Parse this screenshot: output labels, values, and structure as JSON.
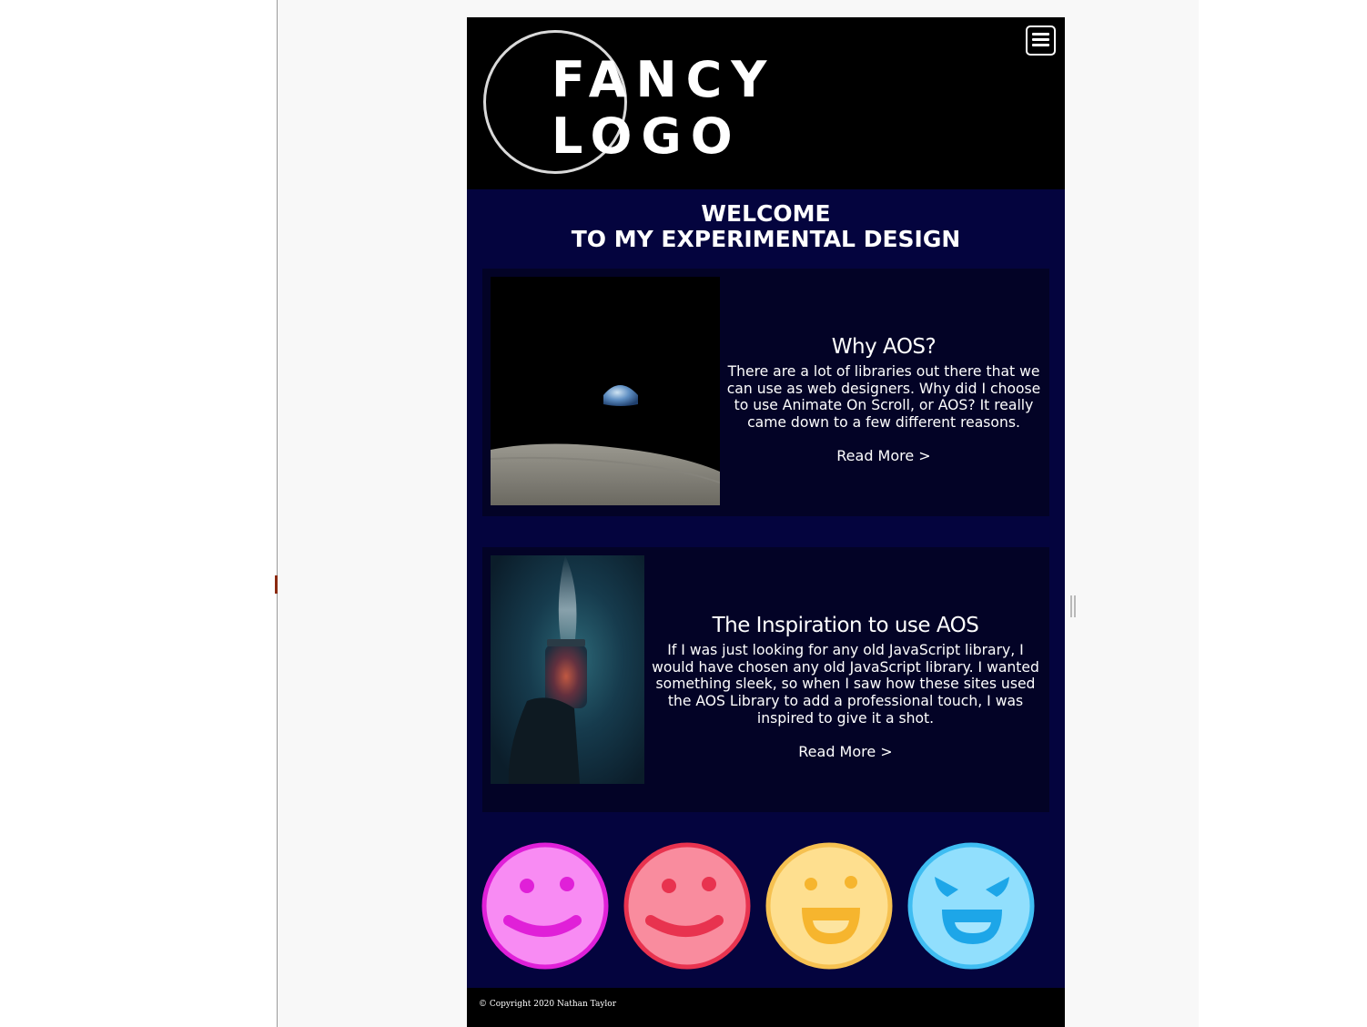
{
  "header": {
    "logo_line1": "FANCY",
    "logo_line2": "LOGO",
    "menu_icon": "hamburger-menu-icon"
  },
  "welcome": {
    "line1": "WELCOME",
    "line2": "TO MY EXPERIMENTAL DESIGN"
  },
  "cards": [
    {
      "image": "earthrise-over-moon",
      "title": "Why AOS?",
      "text": "There are a lot of libraries out there that we can use as web designers. Why did I choose to use Animate On Scroll, or AOS? It really came down to a few different reasons.",
      "link": "Read More >"
    },
    {
      "image": "hand-holding-jar-of-stars",
      "title": "The Inspiration to use AOS",
      "text": "If I was just looking for any old JavaScript library, I would have chosen any old JavaScript library. I wanted something sleek, so when I saw how these sites used the AOS Library to add a professional touch, I was inspired to give it a shot.",
      "link": "Read More >"
    }
  ],
  "faces": [
    {
      "icon": "smiley-face-icon",
      "color": "#f88bf3"
    },
    {
      "icon": "smiley-face-icon",
      "color": "#f98c9e"
    },
    {
      "icon": "grinning-face-icon",
      "color": "#fedf8f"
    },
    {
      "icon": "mischievous-face-icon",
      "color": "#91dffd"
    }
  ],
  "footer": {
    "copyright": "© Copyright 2020 Nathan Taylor"
  },
  "colors": {
    "page_bg": "#04043e",
    "card_bg": "#030326",
    "header_bg": "#000000",
    "text": "#ffffff"
  }
}
